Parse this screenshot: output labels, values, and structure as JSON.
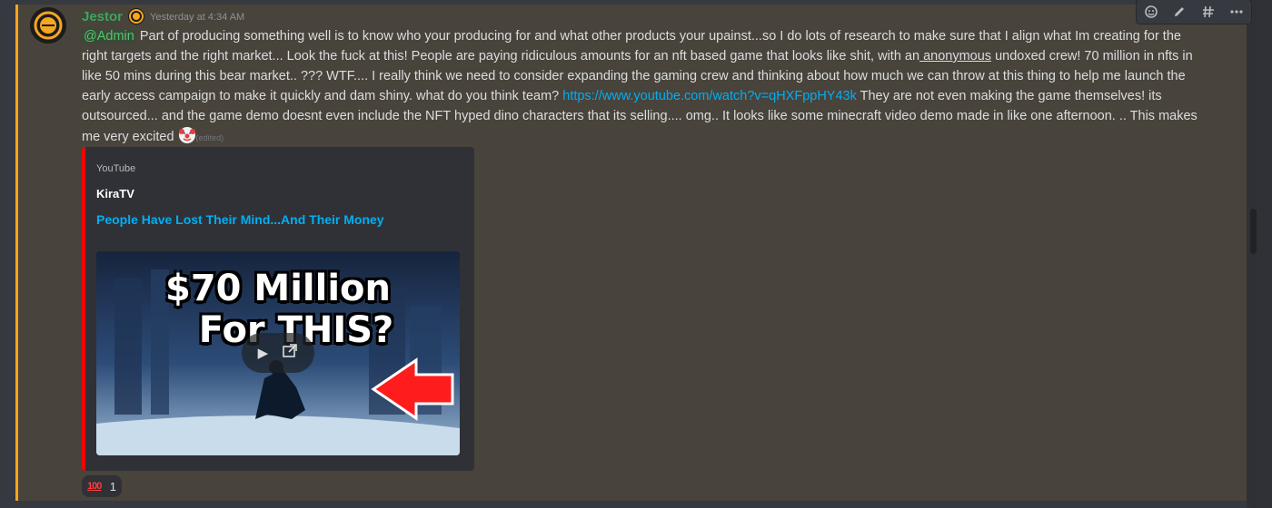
{
  "message": {
    "author": "Jestor",
    "timestamp": "Yesterday at 4:34 AM",
    "mention": "@Admin",
    "text_1": " Part of producing something well is to know who your producing for and what other products your upainst...so I do lots of research to make sure that I align what Im creating for the right targets and the right market...      Look the fuck at this!  People are paying ridiculous amounts for an nft based game that looks like shit, with an",
    "underlined_word": " anonymous",
    "text_2": " undoxed crew!  70 million in nfts in like 50 mins during this bear market.. ??? WTF.... I really think we need to consider expanding the gaming crew and thinking about how much we can throw at this thing to help me launch the early access campaign to make it quickly and dam shiny.    what do you think team? ",
    "link": "https://www.youtube.com/watch?v=qHXFppHY43k",
    "text_3": " They are not even making the game themselves! its outsourced... and the game demo doesnt even include the NFT hyped dino characters that its selling.... omg.. It looks like some minecraft video demo made in like one afternoon.  .. This makes me very excited ",
    "emoji": "clown-face",
    "edited": "(edited)"
  },
  "embed": {
    "provider": "YouTube",
    "author": "KiraTV",
    "title": "People Have Lost Their Mind...And Their Money",
    "thumbnail_line1": "$70 Million",
    "thumbnail_line2": "For THIS?",
    "accent_color": "#ff0000"
  },
  "reaction": {
    "emoji": "100",
    "count": "1"
  },
  "toolbar": {
    "icons": [
      "add-reaction-icon",
      "edit-icon",
      "create-thread-icon",
      "more-icon"
    ]
  },
  "colors": {
    "username": "#3ba55d",
    "link": "#00aff4",
    "highlight_border": "#faa61a"
  }
}
